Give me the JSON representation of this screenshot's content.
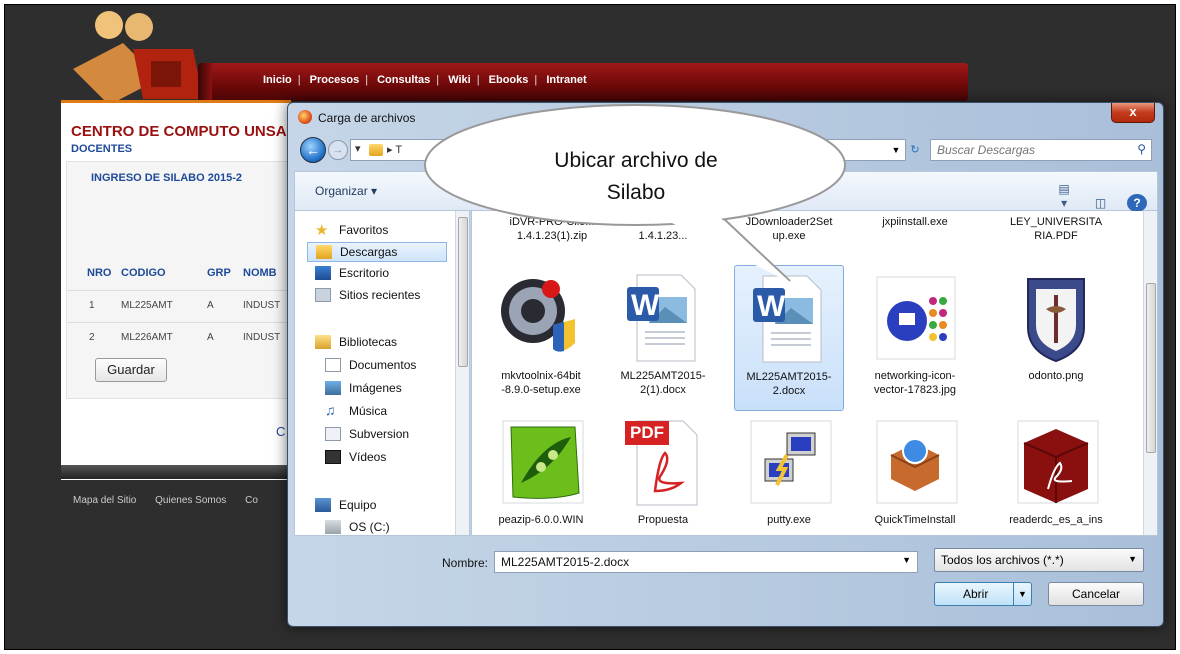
{
  "site": {
    "nav": [
      "Inicio",
      "Procesos",
      "Consultas",
      "Wiki",
      "Ebooks",
      "Intranet"
    ],
    "nav_sep": "|",
    "heading": "CENTRO DE COMPUTO UNSA",
    "subheading": "DOCENTES",
    "section_title": "INGRESO DE SILABO 2015-2",
    "table": {
      "headers": [
        "NRO",
        "CODIGO",
        "GRP",
        "NOMB"
      ],
      "rows": [
        [
          "1",
          "ML225AMT",
          "A",
          "INDUST"
        ],
        [
          "2",
          "ML226AMT",
          "A",
          "INDUST"
        ]
      ]
    },
    "save_label": "Guardar",
    "partial_letter": "C",
    "footer": [
      "Mapa del Sitio",
      "Quienes Somos",
      "Co"
    ]
  },
  "dialog": {
    "title": "Carga de archivos",
    "close_label": "x",
    "path_text": "T",
    "search_placeholder": "Buscar Descargas",
    "organize_label": "Organizar ▾",
    "nav": {
      "favorites": "Favoritos",
      "downloads": "Descargas",
      "desktop": "Escritorio",
      "recent": "Sitios recientes",
      "libraries": "Bibliotecas",
      "documents": "Documentos",
      "images": "Imágenes",
      "music": "Música",
      "subversion": "Subversion",
      "videos": "Vídeos",
      "computer": "Equipo",
      "drive": "OS (C:)"
    },
    "files_row0": [
      "iDVR-PRO-Clie...",
      "1.4.1.23(1).zip",
      "1.4.1.23...",
      "JDownloader2Set",
      "up.exe",
      "jxpiinstall.exe",
      "LEY_UNIVERSITA",
      "RIA.PDF"
    ],
    "files": [
      {
        "line1": "mkvtoolnix-64bit",
        "line2": "-8.9.0-setup.exe"
      },
      {
        "line1": "ML225AMT2015-",
        "line2": "2(1).docx"
      },
      {
        "line1": "ML225AMT2015-",
        "line2": "2.docx"
      },
      {
        "line1": "networking-icon-",
        "line2": "vector-17823.jpg"
      },
      {
        "line1": "odonto.png",
        "line2": ""
      },
      {
        "line1": "peazip-6.0.0.WIN",
        "line2": ""
      },
      {
        "line1": "Propuesta",
        "line2": ""
      },
      {
        "line1": "putty.exe",
        "line2": ""
      },
      {
        "line1": "QuickTimeInstall",
        "line2": ""
      },
      {
        "line1": "readerdc_es_a_ins",
        "line2": ""
      }
    ],
    "pdf_badge": "PDF",
    "filename_label": "Nombre:",
    "filename_value": "ML225AMT2015-2.docx",
    "filter_value": "Todos los archivos (*.*)",
    "open_label": "Abrir",
    "cancel_label": "Cancelar"
  },
  "callout": {
    "line1": "Ubicar archivo de",
    "line2": "Silabo"
  },
  "colors": {
    "accent": "#e07a16",
    "brand_red": "#9a1010",
    "link_blue": "#1e4a9a"
  }
}
